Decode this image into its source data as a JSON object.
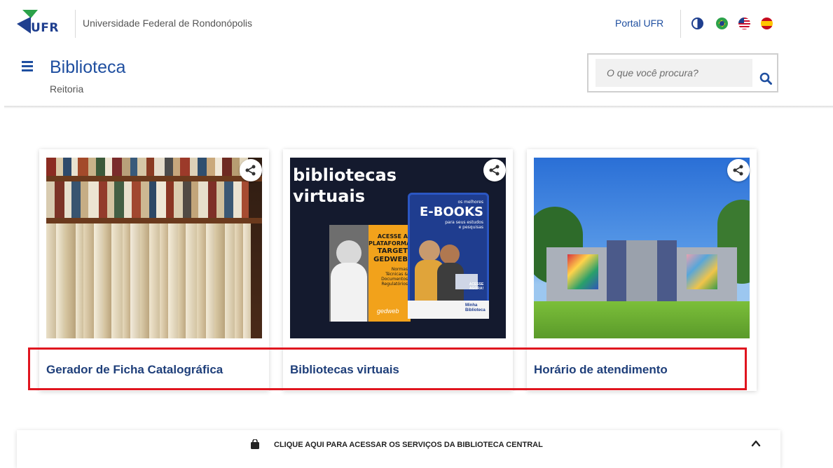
{
  "header": {
    "logo_text": "UFR",
    "university_name": "Universidade Federal de Rondonópolis",
    "portal_link": "Portal UFR",
    "site_title": "Biblioteca",
    "site_subtitle": "Reitoria",
    "search_placeholder": "O que você procura?",
    "icons": [
      "contrast-icon",
      "flag-brazil-icon",
      "flag-usa-icon",
      "flag-spain-icon",
      "menu-icon",
      "search-icon"
    ]
  },
  "cards": [
    {
      "title": "Gerador de Ficha Catalográfica"
    },
    {
      "title": "Bibliotecas virtuais",
      "image_text": {
        "headline_line1": "bibliotecas",
        "headline_line2": "virtuais",
        "ebooks_small": "os melhores",
        "ebooks_big": "E-BOOKS",
        "ebooks_sub1": "para seus estudos",
        "ebooks_sub2": "e pesquisas",
        "target1": "ACESSE A",
        "target2": "PLATAFORMA",
        "target3": "TARGET",
        "target4": "GEDWEB",
        "target_note1": "Normas",
        "target_note2": "Técnicas &",
        "target_note3": "Documentos",
        "target_note4": "Regulatórios",
        "gedweb_brand": "gedweb",
        "acesse_agora1": "ACESSE",
        "acesse_agora2": "AGORA!",
        "minha_biblioteca1": "Minha",
        "minha_biblioteca2": "Biblioteca"
      }
    },
    {
      "title": "Horário de atendimento"
    }
  ],
  "bottom_bar": {
    "label": "CLIQUE AQUI PARA ACESSAR OS SERVIÇOS DA BIBLIOTECA CENTRAL"
  },
  "colors": {
    "primary": "#1f4fa0",
    "card_title": "#1f3f7a",
    "highlight": "#e0151f"
  }
}
